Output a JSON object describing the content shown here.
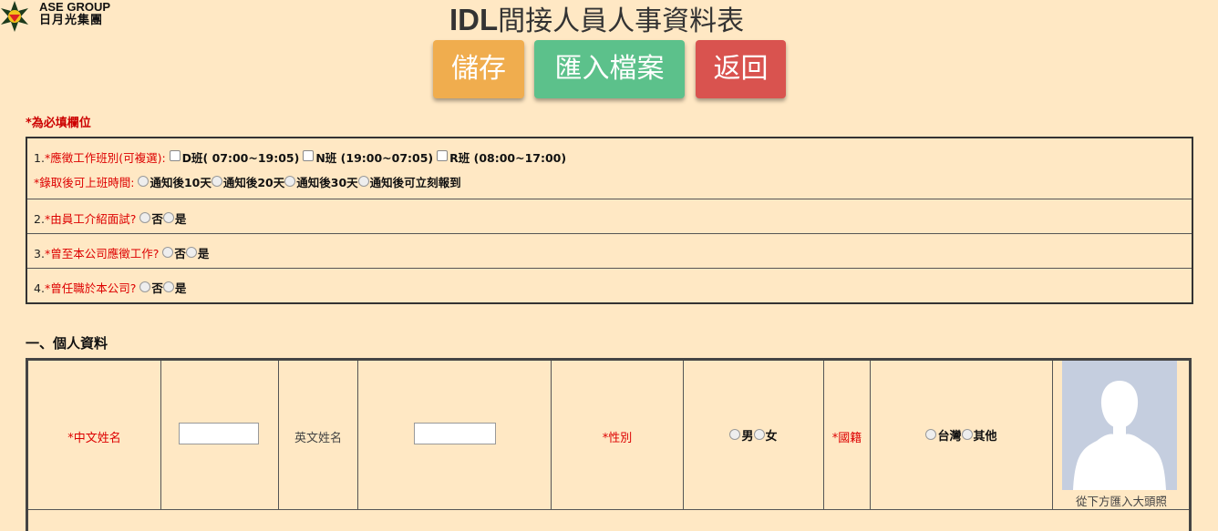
{
  "header": {
    "logo_line1": "ASE GROUP",
    "logo_line2": "日月光集團",
    "title_bold": "IDL",
    "title_rest": "間接人員人事資料表"
  },
  "toolbar": {
    "save_label": "儲存",
    "import_label": "匯入檔案",
    "back_label": "返回",
    "colors": {
      "save": "#f0ad4e",
      "import": "#5cc18b",
      "back": "#d9534f"
    }
  },
  "required_note": "*為必填欄位",
  "questions": {
    "q1_prefix": "1.",
    "q1_label": "*應徵工作班別(可複選):",
    "q1_options": [
      "D班( 07:00~19:05)",
      "N班 (19:00~07:05)",
      "R班 (08:00~17:00)"
    ],
    "start_label": "*錄取後可上班時間:",
    "start_options": [
      "通知後10天",
      "通知後20天",
      "通知後30天",
      "通知後可立刻報到"
    ],
    "q2_prefix": "2.",
    "q2_label": "*由員工介紹面試?",
    "q3_prefix": "3.",
    "q3_label": "*曾至本公司應徵工作?",
    "q4_prefix": "4.",
    "q4_label": "*曾任職於本公司?",
    "no": "否",
    "yes": "是"
  },
  "personal": {
    "section_title": "一、個人資料",
    "chinese_name_label": "*中文姓名",
    "chinese_name_value": "",
    "english_name_label": "英文姓名",
    "english_name_value": "",
    "gender_label": "*性別",
    "gender_options": [
      "男",
      "女"
    ],
    "nationality_label": "*國籍",
    "nationality_options": [
      "台灣",
      "其他"
    ],
    "photo_caption": "從下方匯入大頭照"
  }
}
